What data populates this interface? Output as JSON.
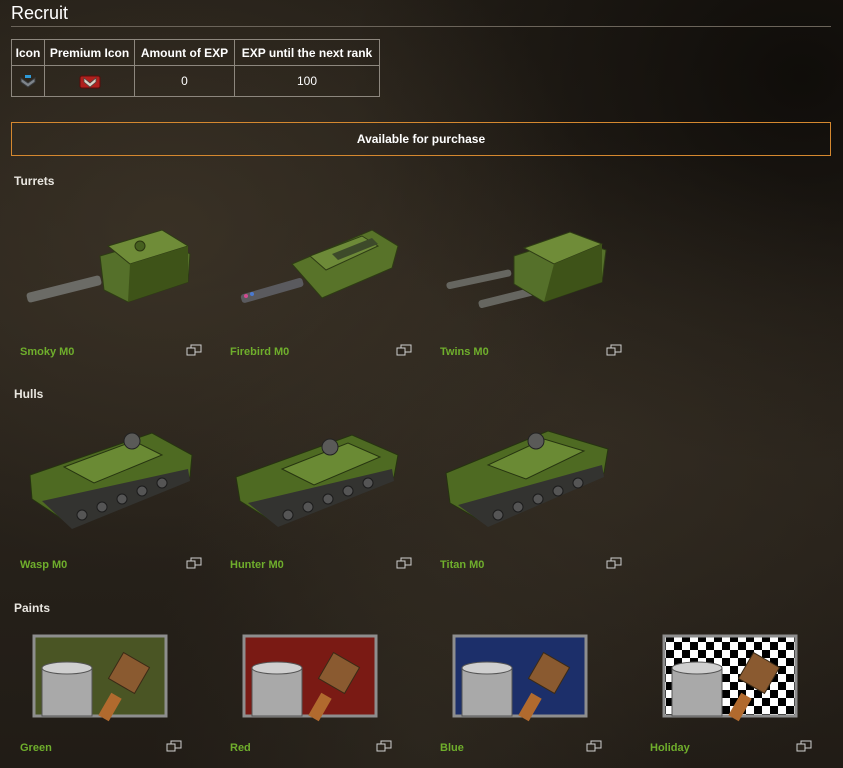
{
  "page": {
    "title": "Recruit"
  },
  "rank_table": {
    "headers": [
      "Icon",
      "Premium Icon",
      "Amount of EXP",
      "EXP until the next rank"
    ],
    "row": {
      "exp": "0",
      "next": "100"
    }
  },
  "banner": {
    "label": "Available for purchase"
  },
  "sections": {
    "turrets": {
      "title": "Turrets",
      "items": [
        {
          "name": "Smoky M0"
        },
        {
          "name": "Firebird M0"
        },
        {
          "name": "Twins M0"
        }
      ]
    },
    "hulls": {
      "title": "Hulls",
      "items": [
        {
          "name": "Wasp M0"
        },
        {
          "name": "Hunter M0"
        },
        {
          "name": "Titan M0"
        }
      ]
    },
    "paints": {
      "title": "Paints",
      "items": [
        {
          "name": "Green",
          "color": "#4a5524"
        },
        {
          "name": "Red",
          "color": "#7a1a14"
        },
        {
          "name": "Blue",
          "color": "#1c2f6a"
        },
        {
          "name": "Holiday",
          "color": "checker"
        }
      ]
    }
  },
  "colors": {
    "accent": "#d5882f",
    "item_name": "#6fae2c",
    "tank_green": "#4f6a1c"
  }
}
